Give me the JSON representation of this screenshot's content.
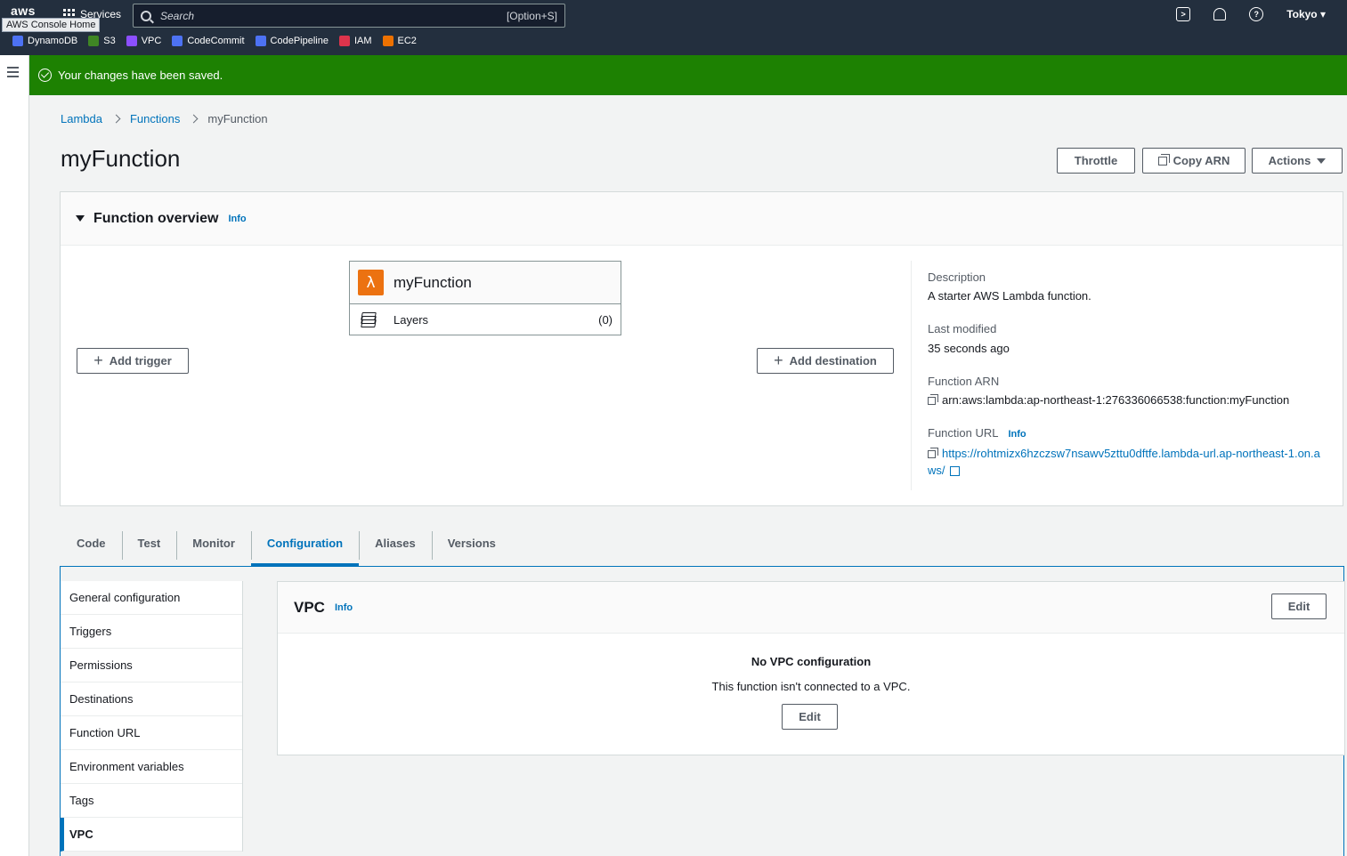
{
  "topnav": {
    "logo": "aws",
    "tooltip": "AWS Console Home",
    "services_label": "Services",
    "search_placeholder": "Search",
    "search_shortcut": "[Option+S]",
    "region": "Tokyo",
    "favorites": [
      {
        "label": "DynamoDB",
        "color": "#4d72f3"
      },
      {
        "label": "S3",
        "color": "#3f8624"
      },
      {
        "label": "VPC",
        "color": "#8c4fff"
      },
      {
        "label": "CodeCommit",
        "color": "#4d72f3"
      },
      {
        "label": "CodePipeline",
        "color": "#4d72f3"
      },
      {
        "label": "IAM",
        "color": "#dd344c"
      },
      {
        "label": "EC2",
        "color": "#ed7100"
      }
    ]
  },
  "flash": {
    "message": "Your changes have been saved.",
    "color": "#1d8102"
  },
  "breadcrumb": {
    "items": [
      "Lambda",
      "Functions"
    ],
    "current": "myFunction"
  },
  "page": {
    "title": "myFunction"
  },
  "header_buttons": {
    "throttle": "Throttle",
    "copy_arn": "Copy ARN",
    "actions": "Actions"
  },
  "overview": {
    "title": "Function overview",
    "info": "Info",
    "function_name": "myFunction",
    "layers_label": "Layers",
    "layers_count": "(0)",
    "add_trigger": "Add trigger",
    "add_destination": "Add destination",
    "description_label": "Description",
    "description_value": "A starter AWS Lambda function.",
    "last_modified_label": "Last modified",
    "last_modified_value": "35 seconds ago",
    "arn_label": "Function ARN",
    "arn_value": "arn:aws:lambda:ap-northeast-1:276336066538:function:myFunction",
    "url_label": "Function URL",
    "url_info": "Info",
    "url_value": "https://rohtmizx6hzczsw7nsawv5zttu0dftfe.lambda-url.ap-northeast-1.on.aws/"
  },
  "tabs": [
    "Code",
    "Test",
    "Monitor",
    "Configuration",
    "Aliases",
    "Versions"
  ],
  "config_nav": [
    "General configuration",
    "Triggers",
    "Permissions",
    "Destinations",
    "Function URL",
    "Environment variables",
    "Tags",
    "VPC"
  ],
  "vpc": {
    "title": "VPC",
    "info": "Info",
    "edit": "Edit",
    "empty_title": "No VPC configuration",
    "empty_text": "This function isn't connected to a VPC.",
    "empty_edit": "Edit"
  }
}
